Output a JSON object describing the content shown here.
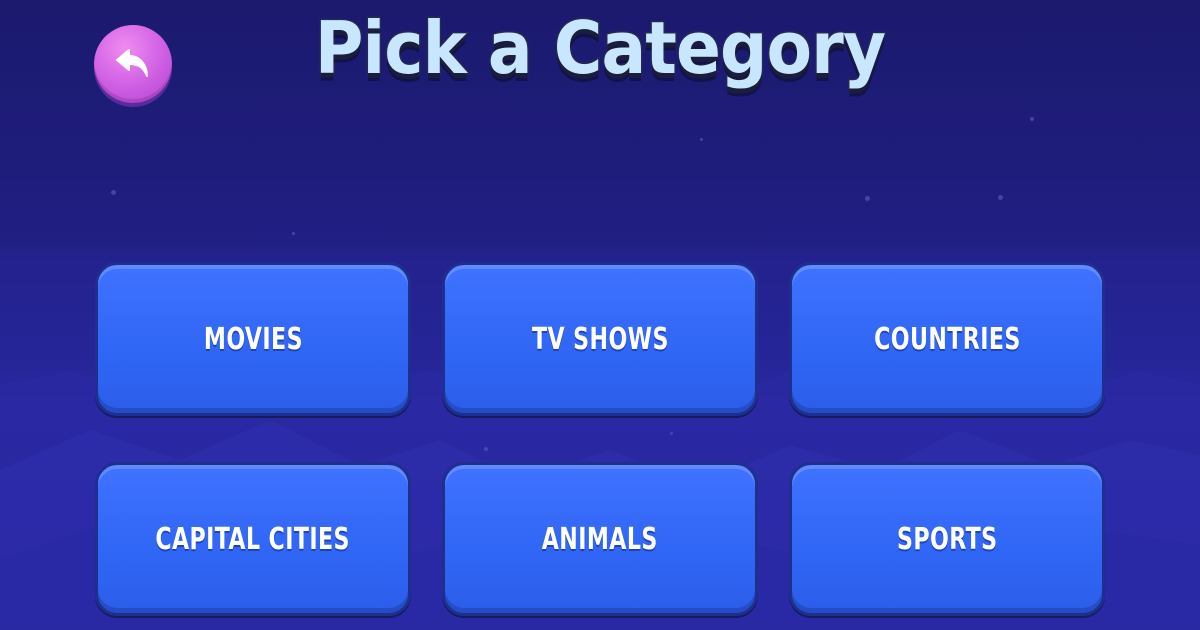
{
  "screen": {
    "title": "Pick a Category",
    "back_icon": "undo-arrow-icon"
  },
  "categories": [
    {
      "label": "MOVIES"
    },
    {
      "label": "TV SHOWS"
    },
    {
      "label": "COUNTRIES"
    },
    {
      "label": "CAPITAL CITIES"
    },
    {
      "label": "ANIMALS"
    },
    {
      "label": "SPORTS"
    }
  ],
  "colors": {
    "background": "#201e80",
    "button_fill": "#3066f5",
    "button_border": "#1e2f8f",
    "back_button": "#d466e6",
    "title_fill": "#c9e6ff"
  }
}
